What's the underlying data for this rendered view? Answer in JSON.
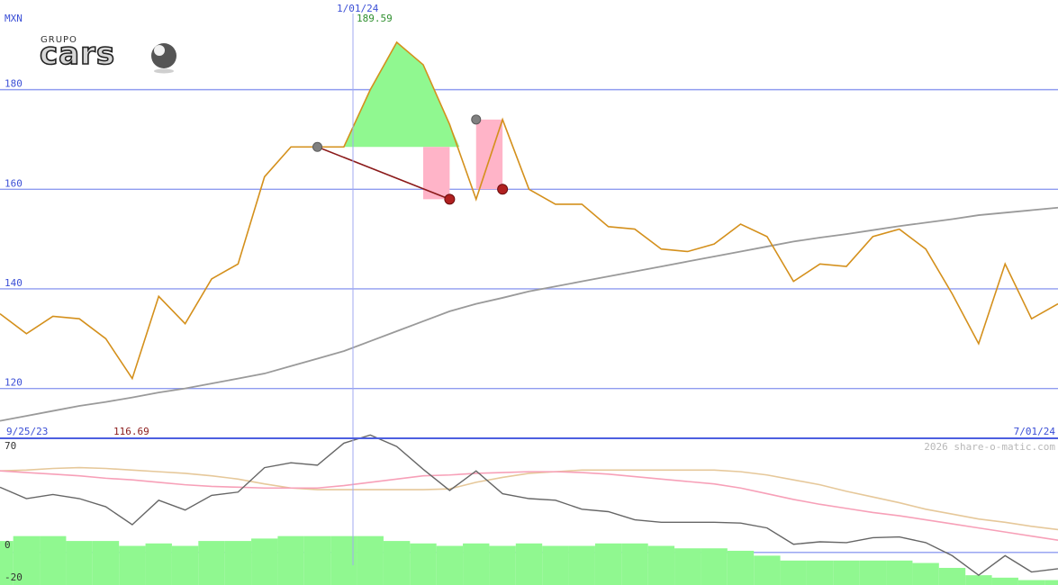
{
  "logo": {
    "line1": "GRUPO",
    "line2": "cars"
  },
  "currency": "MXN",
  "credit": "2026 share-o-matic.com",
  "colors": {
    "price": "#d4901c",
    "ma": "#9a9a9a",
    "grid": "#8f9cf0",
    "up": "#90f890",
    "down": "#ffb4c8",
    "trend": "#8b1a1a",
    "osc": "#666666",
    "osc_pink": "#f7a0b8",
    "osc_tan": "#e6c89a",
    "volume": "#90f890",
    "cursor": "#a0aaf0"
  },
  "chart_data": [
    {
      "type": "line",
      "ylim": [
        110,
        198
      ],
      "yticks": [
        120,
        140,
        160,
        180
      ],
      "x_labels": {
        "start": "9/25/23",
        "cursor": "1/01/24",
        "end": "7/01/24"
      },
      "cursor_index": 13,
      "max_label": "189.59",
      "min_label": "116.69",
      "series": [
        {
          "values": [
            135,
            131,
            134.5,
            134,
            130,
            122,
            138.5,
            133,
            142,
            145,
            162.5,
            168.5,
            168.5,
            168.5,
            180,
            189.5,
            185,
            173,
            158,
            174,
            160,
            157,
            157,
            152.5,
            152,
            148,
            147.5,
            149,
            153,
            150.5,
            141.5,
            145,
            144.5,
            150.5,
            152,
            148,
            139,
            129,
            145,
            134,
            137
          ]
        },
        {
          "values": [
            113.5,
            114.5,
            115.5,
            116.5,
            117.3,
            118.2,
            119.2,
            120,
            121,
            122,
            123,
            124.5,
            126,
            127.5,
            129.5,
            131.5,
            133.5,
            135.5,
            137,
            138.2,
            139.5,
            140.5,
            141.5,
            142.5,
            143.5,
            144.5,
            145.5,
            146.5,
            147.5,
            148.5,
            149.5,
            150.3,
            151,
            151.8,
            152.6,
            153.3,
            154,
            154.8,
            155.3,
            155.8,
            156.3
          ]
        }
      ],
      "markers": {
        "grey": [
          {
            "i": 12,
            "v": 168.5
          },
          {
            "i": 18,
            "v": 174
          }
        ],
        "red": [
          {
            "i": 17,
            "v": 158
          },
          {
            "i": 19,
            "v": 160
          }
        ]
      },
      "trend_line": [
        {
          "i": 12,
          "v": 168.5
        },
        {
          "i": 17,
          "v": 158
        }
      ],
      "up_fill": {
        "from": 12,
        "to": 16,
        "base": 168.5
      },
      "down_boxes": [
        {
          "from": 16,
          "to": 17,
          "top": 168.5,
          "bottom": 158
        },
        {
          "from": 18,
          "to": 19,
          "top": 174,
          "bottom": 160
        }
      ]
    },
    {
      "type": "line",
      "ylim": [
        -20,
        70
      ],
      "yticks": [
        0,
        70
      ],
      "ytick_labels": [
        "0",
        "70",
        "-20"
      ],
      "series": [
        {
          "values": [
            40,
            33,
            35.5,
            33,
            28,
            17,
            32,
            26,
            35,
            37,
            52,
            55,
            53.5,
            67,
            72,
            65,
            51,
            38,
            50,
            36,
            33,
            32,
            26.5,
            25,
            20,
            18.5,
            18.5,
            18.5,
            18,
            15,
            5,
            6.5,
            6,
            9,
            9.5,
            6,
            -2,
            -14,
            -2,
            -12,
            -10
          ]
        },
        {
          "values": [
            50,
            49,
            48,
            47,
            45.5,
            44.5,
            43,
            41.5,
            40.5,
            40,
            39.5,
            39.5,
            39.5,
            41,
            43,
            45,
            47,
            47.5,
            48.5,
            49,
            49.5,
            49.5,
            49,
            48,
            46.5,
            45,
            43.5,
            42,
            39.5,
            36,
            32.5,
            29.5,
            27,
            24.5,
            22.5,
            20,
            17.5,
            15,
            12.5,
            10,
            7.5
          ]
        },
        {
          "values": [
            50,
            50.5,
            51.5,
            52,
            51.5,
            50.5,
            49.5,
            48.5,
            47,
            45,
            42,
            39.5,
            38.5,
            38.5,
            38.5,
            38.5,
            38.5,
            39,
            43,
            46,
            48.5,
            49.5,
            50.5,
            50.5,
            50.5,
            50.5,
            50.5,
            50.5,
            49.5,
            47.5,
            44.5,
            41.5,
            37.5,
            34,
            30.5,
            26.5,
            23.5,
            20.5,
            18.5,
            16,
            14
          ]
        }
      ],
      "volume": [
        18,
        20,
        20,
        18,
        18,
        16,
        17,
        16,
        18,
        18,
        19,
        20,
        20,
        20,
        20,
        18,
        17,
        16,
        17,
        16,
        17,
        16,
        16,
        17,
        17,
        16,
        15,
        15,
        14,
        12,
        10,
        10,
        10,
        10,
        10,
        9,
        7,
        4,
        3,
        2,
        2
      ]
    }
  ]
}
